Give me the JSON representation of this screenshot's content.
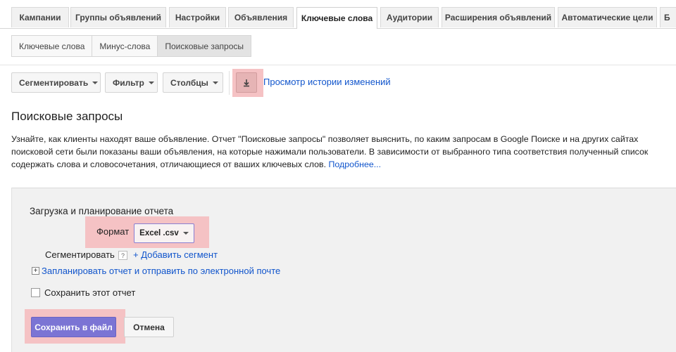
{
  "tabs": [
    {
      "label": "Кампании"
    },
    {
      "label": "Группы объявлений"
    },
    {
      "label": "Настройки"
    },
    {
      "label": "Объявления"
    },
    {
      "label": "Ключевые слова",
      "active": true
    },
    {
      "label": "Аудитории"
    },
    {
      "label": "Расширения объявлений"
    },
    {
      "label": "Автоматические цели"
    },
    {
      "label": "Б"
    }
  ],
  "subtabs": [
    {
      "label": "Ключевые слова"
    },
    {
      "label": "Минус-слова"
    },
    {
      "label": "Поисковые запросы",
      "active": true
    }
  ],
  "toolbar": {
    "segment_label": "Сегментировать",
    "filter_label": "Фильтр",
    "columns_label": "Столбцы",
    "download_icon": "download-icon",
    "history_link": "Просмотр истории изменений"
  },
  "page": {
    "title": "Поисковые запросы",
    "desc_line1": "Узнайте, как клиенты находят ваше объявление. Отчет \"Поисковые запросы\" позволяет выяснить, по каким запросам в Google Поиске и на других сайтах",
    "desc_line2": "поисковой сети были показаны ваши объявления, на которые нажимали пользователи. В зависимости от выбранного типа соответствия полученный список",
    "desc_line3": "содержать слова и словосочетания, отличающиеся от ваших ключевых слов.",
    "more_link": "Подробнее..."
  },
  "report": {
    "title": "Загрузка и планирование отчета",
    "format_label": "Формат",
    "format_value": "Excel .csv",
    "segment_label": "Сегментировать",
    "help_mark": "?",
    "add_segment_link": "+ Добавить сегмент",
    "plus_mark": "+",
    "schedule_link": "Запланировать отчет и отправить по электронной почте",
    "save_report_label": "Сохранить этот отчет",
    "save_file_button": "Сохранить в файл",
    "cancel_button": "Отмена"
  },
  "colors": {
    "highlight": "#f5c2c4",
    "primary_button": "#7b74d4",
    "link": "#1155cc"
  }
}
